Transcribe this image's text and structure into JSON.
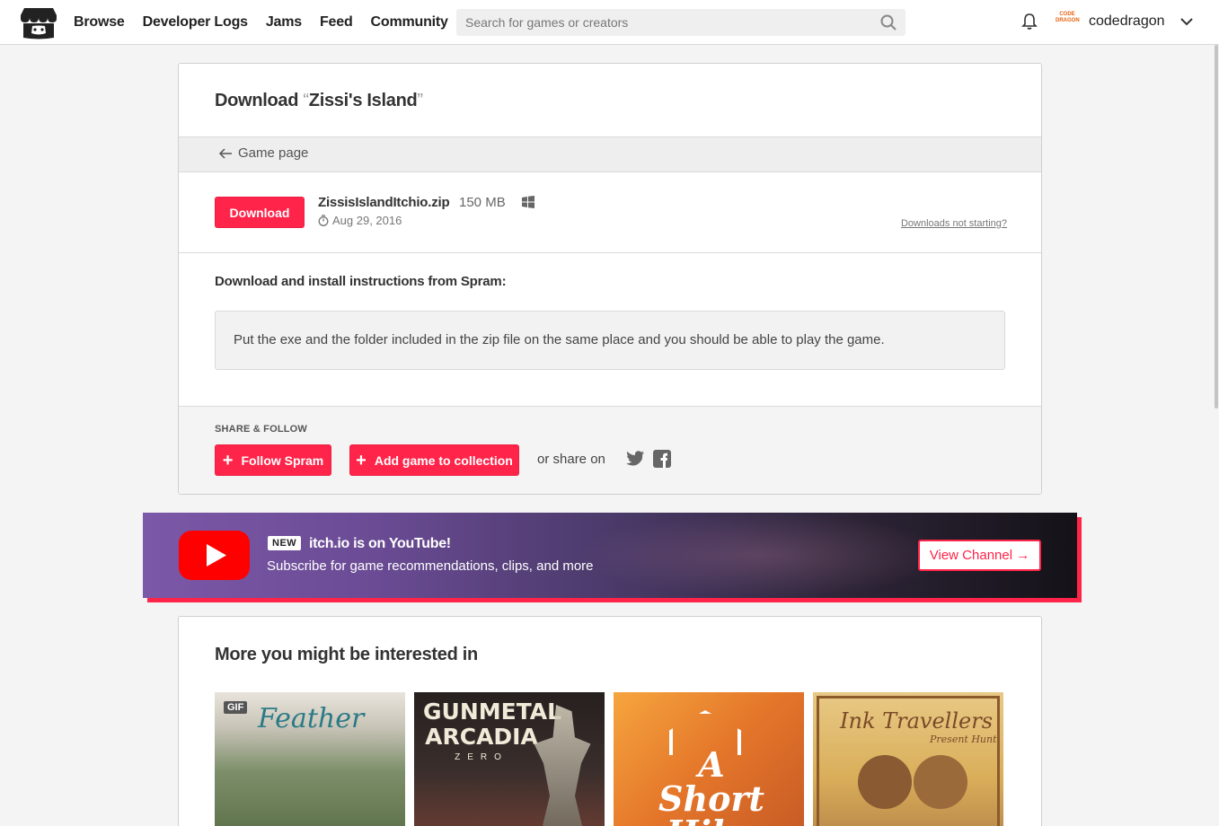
{
  "header": {
    "nav": [
      "Browse",
      "Developer Logs",
      "Jams",
      "Feed",
      "Community"
    ],
    "search_placeholder": "Search for games or creators",
    "username": "codedragon",
    "avatar_text": "CODE DRAGON"
  },
  "download": {
    "title_prefix": "Download",
    "open_quote": "“",
    "game_name": "Zissi's Island",
    "close_quote": "”",
    "back_label": "Game page",
    "button_label": "Download",
    "file_name": "ZissisIslandItchio.zip",
    "file_size": "150 MB",
    "platform_icon": "windows-icon",
    "date": "Aug 29, 2016",
    "not_starting": "Downloads not starting?",
    "instructions_heading": "Download and install instructions from Spram:",
    "instructions_text": "Put the exe and the folder included in the zip file on the same place and you should be able to play the game."
  },
  "share": {
    "label": "SHARE & FOLLOW",
    "follow_label": "Follow Spram",
    "add_label": "Add game to collection",
    "share_on": "or share on"
  },
  "youtube": {
    "badge": "NEW",
    "title": "itch.io is on YouTube!",
    "subtitle": "Subscribe for game recommendations, clips, and more",
    "button": "View Channel →"
  },
  "more": {
    "heading": "More you might be interested in",
    "games": [
      {
        "badge": "GIF",
        "art": "Feather"
      },
      {
        "art_line1": "GUNMETAL",
        "art_line2": "ARCADIA",
        "art_line3": "ZERO"
      },
      {
        "art": "A Short Hike"
      },
      {
        "art": "Ink Travellers",
        "art2": "Present Hunt"
      }
    ]
  },
  "colors": {
    "accent": "#ff2449",
    "background": "#f4f4f4"
  }
}
